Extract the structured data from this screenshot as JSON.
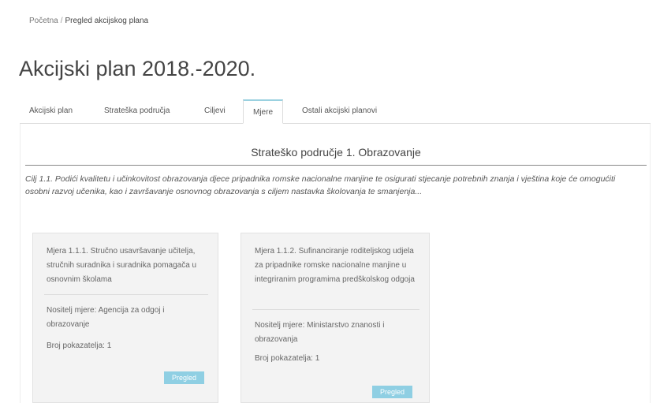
{
  "breadcrumb": {
    "home": "Početna",
    "separator": "/",
    "current": "Pregled akcijskog plana"
  },
  "page_title": "Akcijski plan 2018.-2020.",
  "tabs": [
    {
      "label": "Akcijski plan",
      "active": false
    },
    {
      "label": "Strateška područja",
      "active": false
    },
    {
      "label": "Ciljevi",
      "active": false
    },
    {
      "label": "Mjere",
      "active": true
    },
    {
      "label": "Ostali akcijski planovi",
      "active": false
    }
  ],
  "section": {
    "title": "Strateško područje 1. Obrazovanje",
    "goal": "Cilj 1.1. Podići kvalitetu i učinkovitost obrazovanja djece pripadnika romske nacionalne manjine te osigurati stjecanje potrebnih znanja i vještina koje će omogućiti osobni razvoj učenika, kao i završavanje osnovnog obrazovanja s ciljem nastavka školovanja te smanjenja..."
  },
  "cards": [
    {
      "measure": "Mjera 1.1.1. Stručno usavršavanje učitelja, stručnih suradnika i suradnika pomagača u osnovnim školama",
      "holder": "Nositelj mjere: Agencija za odgoj i obrazovanje",
      "count": "Broj pokazatelja: 1",
      "button": "Pregled"
    },
    {
      "measure": "Mjera 1.1.2. Sufinanciranje roditeljskog udjela za pripadnike romske nacionalne manjine u integriranim programima predškolskog odgoja",
      "holder": "Nositelj mjere: Ministarstvo znanosti i obrazovanja",
      "count": "Broj pokazatelja: 1",
      "button": "Pregled"
    }
  ],
  "colors": {
    "accent": "#8fcfe3",
    "card_bg": "#f3f3f3",
    "tab_active_top": "#9ad1e0"
  }
}
